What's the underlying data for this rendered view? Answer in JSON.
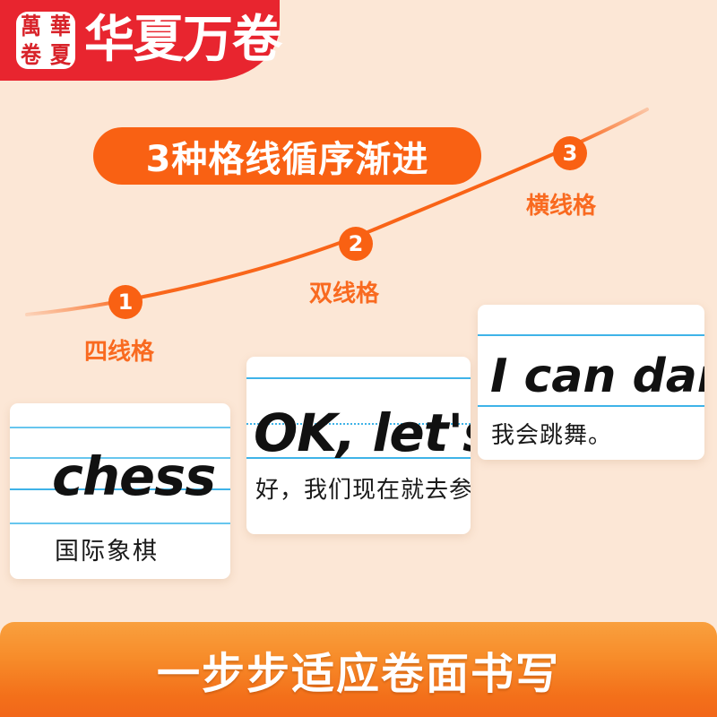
{
  "brand": {
    "seal_chars": [
      "萬",
      "華",
      "卷",
      "夏"
    ],
    "name": "华夏万卷",
    "banner_color": "#e8252f"
  },
  "headline": {
    "text": "3种格线循序渐进",
    "pill_color": "#f96113",
    "text_color": "#ffffff"
  },
  "progression": {
    "accent_color": "#f96113",
    "steps": [
      {
        "number": "1",
        "label": "四线格"
      },
      {
        "number": "2",
        "label": "双线格"
      },
      {
        "number": "3",
        "label": "横线格"
      }
    ]
  },
  "cards": [
    {
      "grid_type": "four-line",
      "english": "chess",
      "chinese": "国际象棋",
      "rule_color": "#3fb3e8"
    },
    {
      "grid_type": "double-line",
      "english": "OK, let's",
      "chinese": "好，我们现在就去参",
      "rule_color": "#3fb3e8"
    },
    {
      "grid_type": "single-line",
      "english": "I can dan",
      "chinese": "我会跳舞。",
      "rule_color": "#3fb3e8"
    }
  ],
  "footer": {
    "text": "一步步适应卷面书写",
    "gradient_from": "#f9a03e",
    "gradient_to": "#f2671a"
  }
}
